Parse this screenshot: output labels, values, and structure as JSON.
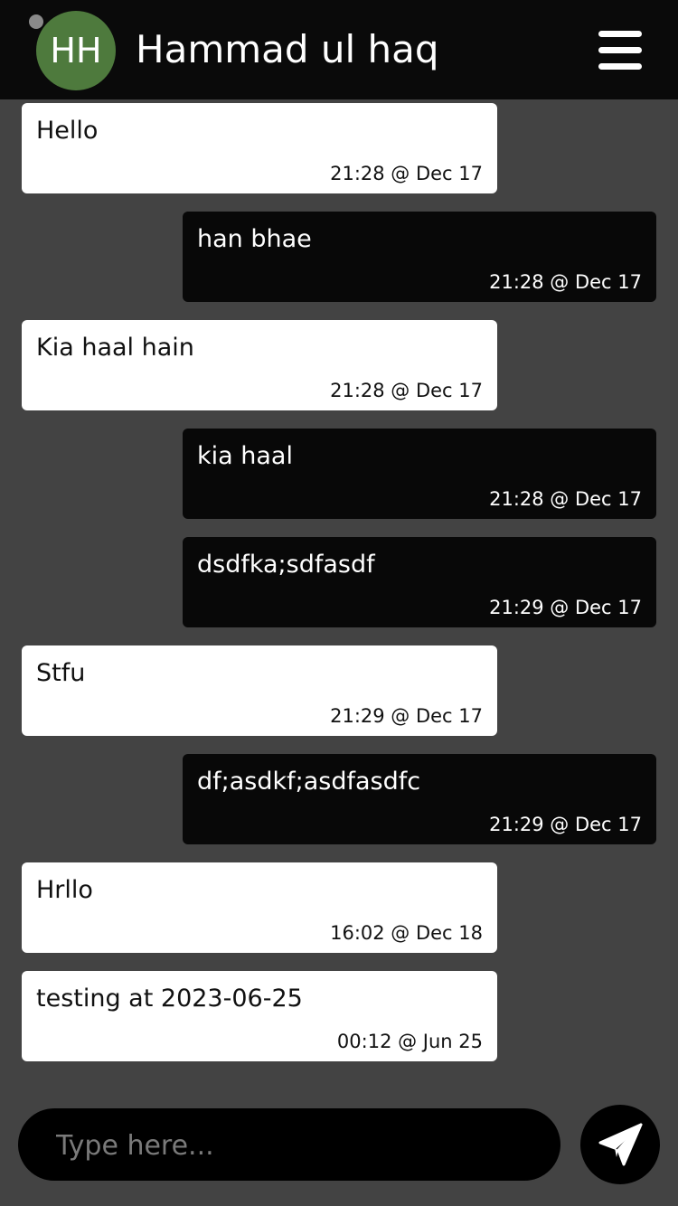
{
  "header": {
    "avatar_initials": "HH",
    "contact_name": "Hammad ul haq",
    "menu_icon": "hamburger-menu-icon",
    "status_icon": "status-dot-icon"
  },
  "messages": [
    {
      "direction": "in",
      "text": "Hello",
      "time": "21:28 @ Dec 17"
    },
    {
      "direction": "out",
      "text": "han bhae",
      "time": "21:28 @ Dec 17"
    },
    {
      "direction": "in",
      "text": "Kia haal hain",
      "time": "21:28 @ Dec 17"
    },
    {
      "direction": "out",
      "text": "kia haal",
      "time": "21:28 @ Dec 17"
    },
    {
      "direction": "out",
      "text": "dsdfka;sdfasdf",
      "time": "21:29 @ Dec 17"
    },
    {
      "direction": "in",
      "text": "Stfu",
      "time": "21:29 @ Dec 17"
    },
    {
      "direction": "out",
      "text": "df;asdkf;asdfasdfc",
      "time": "21:29 @ Dec 17"
    },
    {
      "direction": "in",
      "text": "Hrllo",
      "time": "16:02 @ Dec 18"
    },
    {
      "direction": "in",
      "text": "testing at 2023-06-25",
      "time": "00:12 @ Jun 25"
    }
  ],
  "composer": {
    "placeholder": "Type here...",
    "value": "",
    "send_icon": "paper-plane-icon"
  },
  "colors": {
    "background": "#434343",
    "header": "#0a0a0a",
    "avatar": "#4e7a3d",
    "incoming_bubble": "#ffffff",
    "outgoing_bubble": "#080808"
  }
}
